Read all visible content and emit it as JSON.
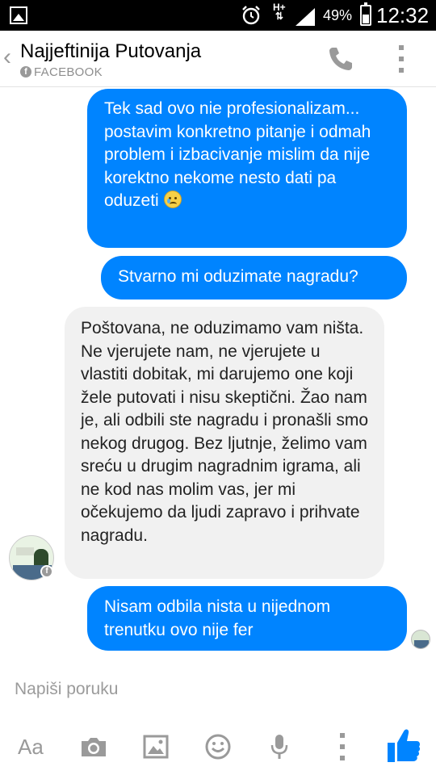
{
  "status_bar": {
    "network": "H+",
    "battery": "49%",
    "battery_level": 0.49,
    "time": "12:32"
  },
  "header": {
    "title": "Najjeftinija Putovanja",
    "subtitle": "FACEBOOK"
  },
  "messages": [
    {
      "direction": "outgoing",
      "text": "Tek sad ovo nie profesionalizam... postavim konkretno pitanje i odmah problem i izbacivanje mislim da nije korektno nekome nesto dati pa oduzeti",
      "emoji": "crying-face"
    },
    {
      "direction": "outgoing",
      "text": "Stvarno mi oduzimate nagradu?"
    },
    {
      "direction": "incoming",
      "text": "Poštovana, ne oduzimamo vam ništa. Ne vjerujete nam, ne vjerujete u vlastiti dobitak, mi darujemo one koji žele putovati i nisu skeptični. Žao nam je, ali odbili ste nagradu i pronašli smo nekog drugog. Bez ljutnje, želimo vam sreću u drugim nagradnim igrama, ali ne kod nas molim vas, jer mi očekujemo da ljudi zapravo i prihvate nagradu."
    },
    {
      "direction": "outgoing",
      "text": "Nisam odbila nista u nijednom trenutku ovo nije fer"
    }
  ],
  "composer": {
    "placeholder": "Napiši poruku",
    "text_tool_label": "Aa"
  },
  "colors": {
    "outgoing_bubble": "#0084ff",
    "incoming_bubble": "#f1f1f1",
    "like_icon": "#0084ff"
  }
}
